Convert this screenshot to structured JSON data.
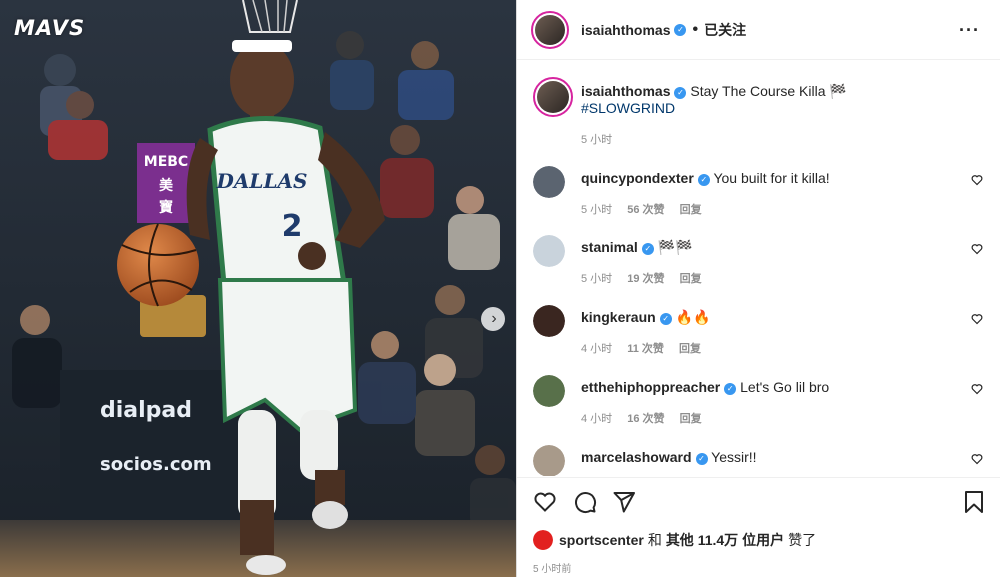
{
  "photo": {
    "logo": "MAVS",
    "next_icon": "chevron-right-icon"
  },
  "header": {
    "username": "isaiahthomas",
    "dot": "•",
    "follow_label": "已关注",
    "more_icon": "more-icon"
  },
  "caption": {
    "username": "isaiahthomas",
    "text": "Stay The Course Killa 🏁",
    "hashtag": "#SLOWGRIND",
    "time": "5 小时"
  },
  "comments": [
    {
      "username": "quincypondexter",
      "text": "You built for it killa!",
      "time": "5 小时",
      "likes": "56 次赞",
      "reply": "回复",
      "avatar_color": "#5b6470"
    },
    {
      "username": "stanimal",
      "text": "🏁🏁",
      "time": "5 小时",
      "likes": "19 次赞",
      "reply": "回复",
      "avatar_color": "#c9d3dc"
    },
    {
      "username": "kingkeraun",
      "text": "🔥🔥",
      "time": "4 小时",
      "likes": "11 次赞",
      "reply": "回复",
      "avatar_color": "#3a2620"
    },
    {
      "username": "etthehiphoppreacher",
      "text": "Let's Go lil bro",
      "time": "4 小时",
      "likes": "16 次赞",
      "reply": "回复",
      "avatar_color": "#58704a"
    },
    {
      "username": "marcelashoward",
      "text": "Yessir!!",
      "time": "",
      "likes": "",
      "reply": "",
      "avatar_color": "#a89a8a"
    }
  ],
  "likes": {
    "username": "sportscenter",
    "middle": "和",
    "others": "其他 11.4万 位用户",
    "suffix": "赞了"
  },
  "timestamp": "5 小时前",
  "colors": {
    "verified": "#3897f0",
    "ring": "#d6249f",
    "hashtag": "#00376b",
    "meta": "#8e8e8e"
  }
}
